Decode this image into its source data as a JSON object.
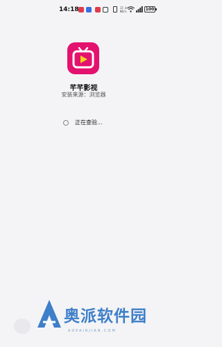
{
  "status_bar": {
    "time": "14:18",
    "network_speed": "17.4\nKB/s",
    "battery_level": "100",
    "notification_icons": [
      {
        "name": "app-notification-icon-1",
        "color": "#e13a4a"
      },
      {
        "name": "app-notification-icon-2",
        "color": "#3a6fe1"
      },
      {
        "name": "app-notification-icon-3",
        "color": "#e13a4a"
      },
      {
        "name": "app-notification-icon-4",
        "color": "#333333"
      }
    ]
  },
  "app": {
    "name": "芊芊影视",
    "install_source": "安装来源：浏览器",
    "icon": "tv-icon",
    "icon_color": "#e4126f"
  },
  "status": {
    "checking_text": "正在查验..."
  },
  "watermark": {
    "text": "奥派软件园",
    "subtext": "AOPAIRJIAN.COM",
    "color": "#3e7fc9"
  }
}
